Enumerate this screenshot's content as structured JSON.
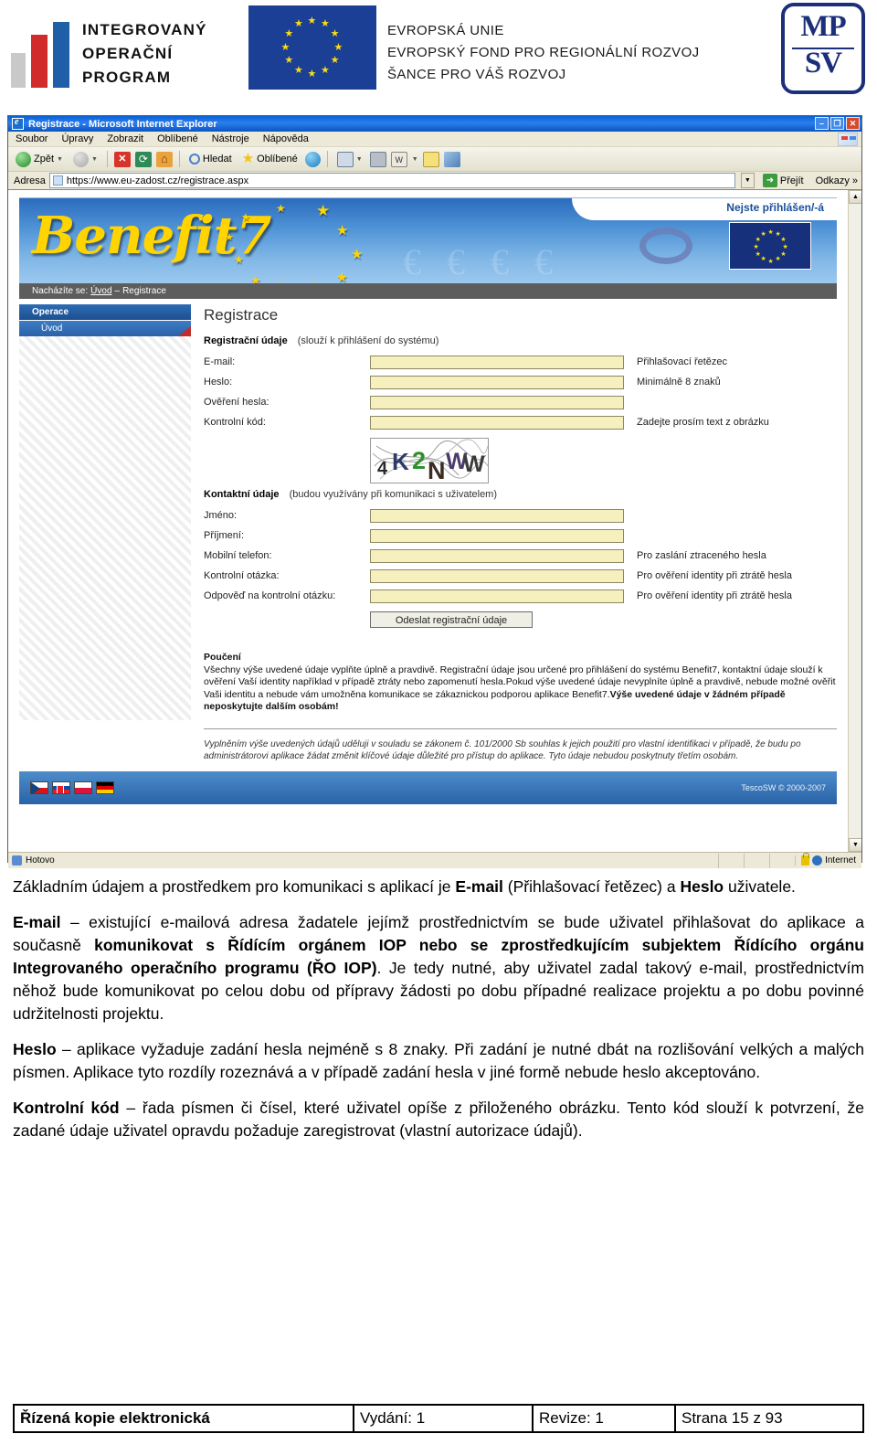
{
  "header": {
    "iop_lines": [
      "INTEGROVANÝ",
      "OPERAČNÍ",
      "PROGRAM"
    ],
    "eu_lines": [
      "EVROPSKÁ UNIE",
      "EVROPSKÝ FOND PRO REGIONÁLNÍ ROZVOJ",
      "ŠANCE PRO VÁŠ ROZVOJ"
    ],
    "mpsv_top": "MP",
    "mpsv_bottom": "SV"
  },
  "browser": {
    "title": "Registrace - Microsoft Internet Explorer",
    "minimize": "–",
    "maximize": "❐",
    "close": "✕",
    "menu": [
      "Soubor",
      "Úpravy",
      "Zobrazit",
      "Oblíbené",
      "Nástroje",
      "Nápověda"
    ],
    "toolbar": {
      "back": "Zpět",
      "forward": "",
      "stop": "✕",
      "refresh": "⟳",
      "home": "⌂",
      "search": "Hledat",
      "favorites": "Oblíbené",
      "history": "",
      "mail": "",
      "print": "",
      "edit": "W",
      "notes": "",
      "messenger": ""
    },
    "address_label": "Adresa",
    "url": "https://www.eu-zadost.cz/registrace.aspx",
    "go": "Přejít",
    "links": "Odkazy",
    "links_chevron": "»",
    "status_text": "Hotovo",
    "status_zone": "Internet"
  },
  "app": {
    "logo_text": "Benefit7",
    "login_status": "Nejste přihlášen/-á",
    "breadcrumb_prefix": "Nacházíte se:",
    "breadcrumb_home": "Úvod",
    "breadcrumb_sep": "–",
    "breadcrumb_current": "Registrace",
    "sidebar": {
      "heading": "Operace",
      "items": [
        {
          "label": "Úvod"
        }
      ]
    },
    "page_title": "Registrace",
    "reg_section": {
      "title": "Registrační údaje",
      "note": "(slouží k přihlášení do systému)",
      "fields": [
        {
          "label": "E-mail:",
          "value": "",
          "hint": "Přihlašovací řetězec"
        },
        {
          "label": "Heslo:",
          "value": "",
          "hint": "Minimálně 8 znaků"
        },
        {
          "label": "Ověření hesla:",
          "value": "",
          "hint": ""
        },
        {
          "label": "Kontrolní kód:",
          "value": "",
          "hint": "Zadejte prosím text z obrázku"
        }
      ],
      "captcha_text": "4K2NWW"
    },
    "contact_section": {
      "title": "Kontaktní údaje",
      "note": "(budou využívány při komunikaci s uživatelem)",
      "fields": [
        {
          "label": "Jméno:",
          "value": "",
          "hint": ""
        },
        {
          "label": "Příjmení:",
          "value": "",
          "hint": ""
        },
        {
          "label": "Mobilní telefon:",
          "value": "",
          "hint": "Pro zaslání ztraceného hesla"
        },
        {
          "label": "Kontrolní otázka:",
          "value": "",
          "hint": "Pro ověření identity při ztrátě hesla"
        },
        {
          "label": "Odpověď na kontrolní otázku:",
          "value": "",
          "hint": "Pro ověření identity při ztrátě hesla"
        }
      ]
    },
    "submit_label": "Odeslat registrační údaje",
    "instruction": {
      "title": "Poučení",
      "body": "Všechny výše uvedené údaje vyplňte úplně a pravdivě. Registrační údaje jsou určené pro přihlášení do systému Benefit7, kontaktní údaje slouží k ověření Vaší identity například v případě ztráty nebo zapomenutí hesla.Pokud výše uvedené údaje nevyplníte úplně a pravdivě, nebude možné ověřit Vaši identitu a nebude vám umožněna komunikace se zákaznickou podporou aplikace Benefit7.",
      "body_bold": "Výše uvedené údaje v žádném případě neposkytujte dalším osobám!"
    },
    "consent": "Vyplněním výše uvedených údajů uděluji v souladu se zákonem č. 101/2000 Sb souhlas k jejich použití pro vlastní identifikaci v případě, že budu po administrátorovi aplikace žádat změnit klíčové údaje důležité pro přístup do aplikace. Tyto údaje nebudou poskytnuty třetím osobám.",
    "footer": {
      "flags": [
        "cz",
        "sk",
        "pl",
        "de"
      ],
      "copyright": "TescoSW © 2000-2007"
    }
  },
  "document": {
    "paragraphs": [
      {
        "parts": [
          {
            "t": "Základním údajem a prostředkem pro komunikaci s aplikací je ",
            "b": false
          },
          {
            "t": "E-mail",
            "b": true
          },
          {
            "t": " (Přihlašovací řetězec) a ",
            "b": false
          },
          {
            "t": "Heslo",
            "b": true
          },
          {
            "t": " uživatele.",
            "b": false
          }
        ]
      },
      {
        "parts": [
          {
            "t": "E-mail",
            "b": true
          },
          {
            "t": " – existující e-mailová adresa žadatele jejímž prostřednictvím se bude uživatel přihlašovat do aplikace a současně ",
            "b": false
          },
          {
            "t": "komunikovat s Řídícím orgánem IOP nebo se zprostředkujícím subjektem Řídícího orgánu Integrovaného operačního programu (ŘO IOP)",
            "b": true
          },
          {
            "t": ". Je tedy nutné, aby uživatel zadal takový e-mail, prostřednictvím něhož bude komunikovat po celou dobu od přípravy žádosti po dobu případné realizace projektu a po dobu povinné udržitelnosti projektu.",
            "b": false
          }
        ]
      },
      {
        "parts": [
          {
            "t": "Heslo",
            "b": true
          },
          {
            "t": " – aplikace vyžaduje zadání hesla  nejméně s 8 znaky. Při zadání je nutné dbát na rozlišování velkých a malých písmen. Aplikace tyto rozdíly rozeznává a v případě zadání hesla v jiné formě nebude heslo akceptováno.",
            "b": false
          }
        ]
      },
      {
        "parts": [
          {
            "t": "Kontrolní kód",
            "b": true
          },
          {
            "t": " – řada písmen či čísel, které uživatel opíše z přiloženého obrázku. Tento kód slouží k potvrzení, že zadané údaje uživatel opravdu požaduje zaregistrovat (vlastní autorizace údajů).",
            "b": false
          }
        ]
      }
    ]
  },
  "doc_footer": {
    "copy_type": "Řízená kopie elektronická",
    "edition": "Vydání: 1",
    "revision": "Revize: 1",
    "page": "Strana 15 z 93"
  }
}
